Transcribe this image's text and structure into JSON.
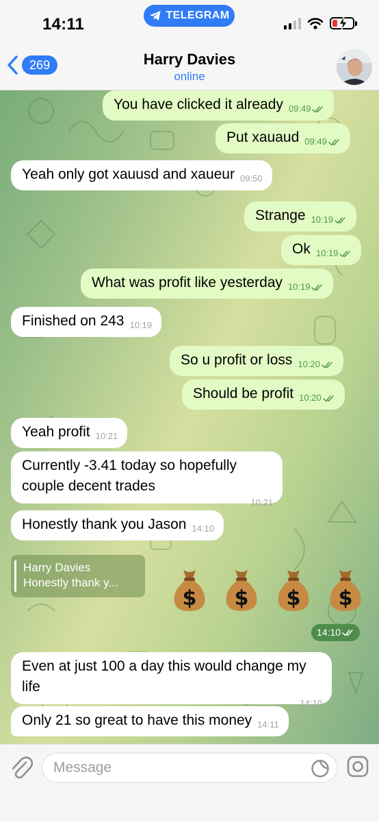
{
  "status_bar": {
    "time": "14:11",
    "app_pill": "TELEGRAM",
    "battery_color": "#e8392f"
  },
  "header": {
    "back_count": "269",
    "name": "Harry Davies",
    "status": "online"
  },
  "messages": [
    {
      "dir": "out",
      "text": "You have clicked it already",
      "time": "09:49"
    },
    {
      "dir": "out",
      "text": "Put xauaud",
      "time": "09:49"
    },
    {
      "dir": "in",
      "text": "Yeah only got xauusd and xaueur",
      "time": "09:50"
    },
    {
      "dir": "out",
      "text": "Strange",
      "time": "10:19"
    },
    {
      "dir": "out",
      "text": "Ok",
      "time": "10:19"
    },
    {
      "dir": "out",
      "text": "What was profit like yesterday",
      "time": "10:19"
    },
    {
      "dir": "in",
      "text": "Finished on 243",
      "time": "10:19"
    },
    {
      "dir": "out",
      "text": "So u profit or loss",
      "time": "10:20"
    },
    {
      "dir": "out",
      "text": "Should be profit",
      "time": "10:20"
    },
    {
      "dir": "in",
      "text": "Yeah profit",
      "time": "10:21"
    },
    {
      "dir": "in",
      "text": "Currently -3.41 today so hopefully couple decent trades",
      "time": "10:21"
    },
    {
      "dir": "in",
      "text": "Honestly thank you Jason",
      "time": "14:10"
    },
    {
      "dir": "in",
      "text": "Even at just 100 a day this would change my life",
      "time": "14:10"
    },
    {
      "dir": "in",
      "text": "Only 21 so great to have this money",
      "time": "14:11"
    }
  ],
  "emoji_message": {
    "reply_name": "Harry Davies",
    "reply_text": "Honestly thank y...",
    "emoji": [
      "money-bag",
      "money-bag",
      "money-bag",
      "money-bag"
    ],
    "time": "14:10"
  },
  "input": {
    "placeholder": "Message"
  },
  "colors": {
    "accent": "#2f7cf6",
    "outgoing_bubble": "#e2fbc4",
    "incoming_bubble": "#ffffff",
    "read_ticks": "#4e9a46"
  },
  "icons": [
    "telegram-icon",
    "signal-icon",
    "wifi-icon",
    "battery-icon",
    "back-chevron-icon",
    "double-check-icon",
    "paperclip-icon",
    "sticker-icon",
    "camera-icon"
  ]
}
